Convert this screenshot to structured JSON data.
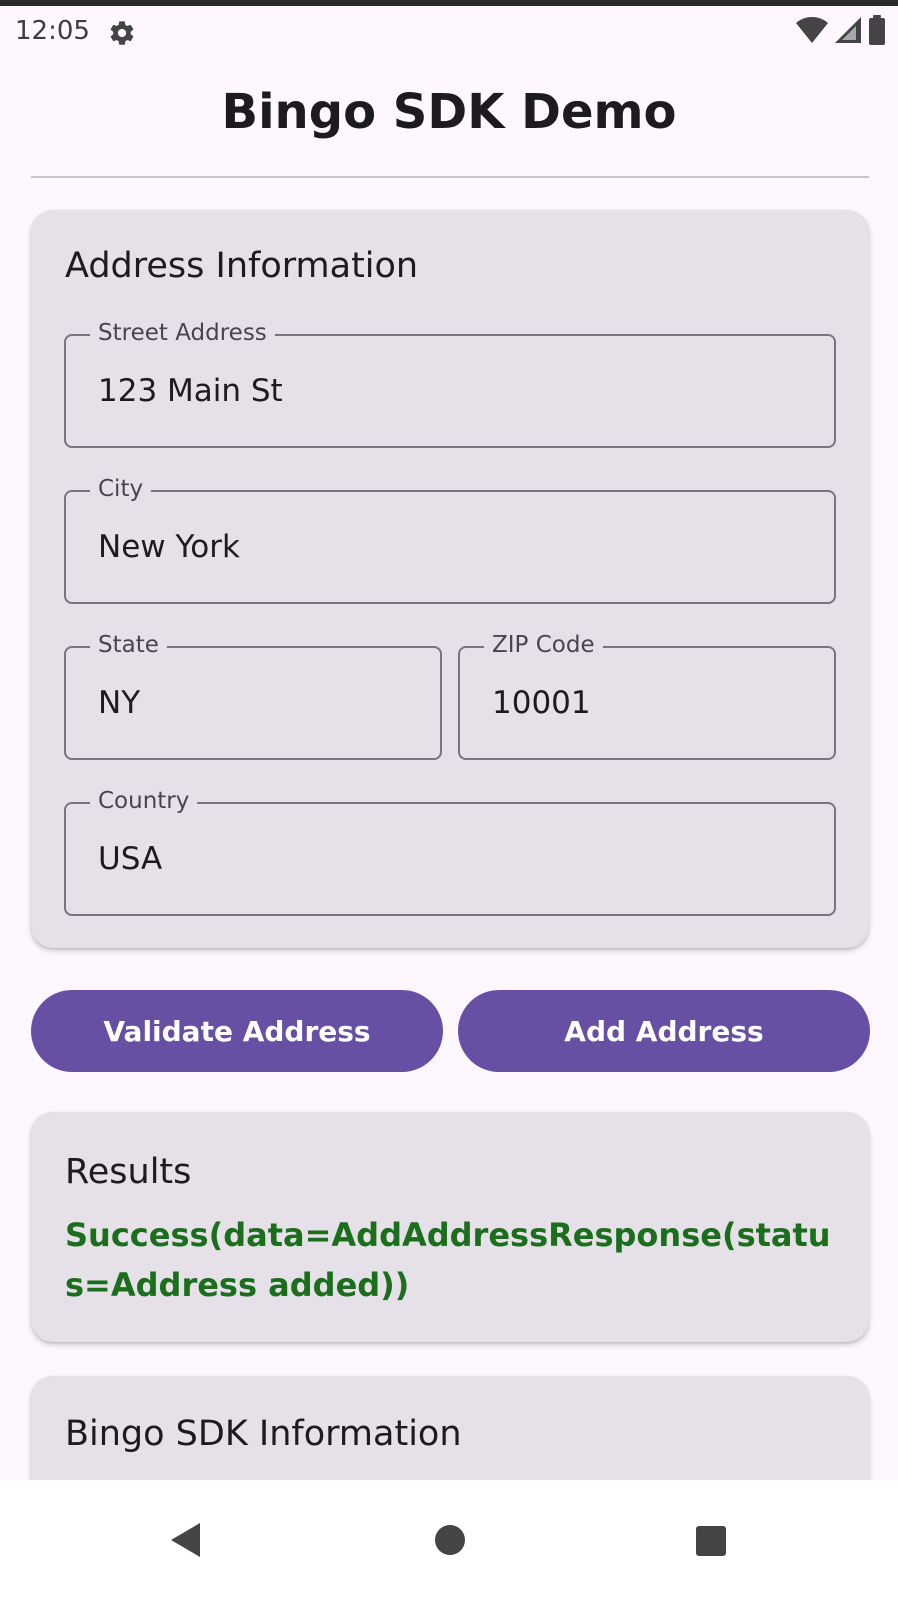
{
  "status_bar": {
    "time": "12:05",
    "icons": [
      "settings-icon",
      "wifi-icon",
      "signal-icon",
      "battery-icon"
    ]
  },
  "app": {
    "title": "Bingo SDK Demo"
  },
  "address_card": {
    "title": "Address Information",
    "fields": {
      "street": {
        "label": "Street Address",
        "value": "123 Main St"
      },
      "city": {
        "label": "City",
        "value": "New York"
      },
      "state": {
        "label": "State",
        "value": "NY"
      },
      "zip": {
        "label": "ZIP Code",
        "value": "10001"
      },
      "country": {
        "label": "Country",
        "value": "USA"
      }
    }
  },
  "actions": {
    "validate_label": "Validate Address",
    "add_label": "Add Address"
  },
  "results_card": {
    "title": "Results",
    "text": "Success(data=AddAddressResponse(status=Address added))"
  },
  "sdk_card": {
    "title": "Bingo SDK Information"
  },
  "nav": {
    "icons": [
      "back-icon",
      "home-icon",
      "recents-icon"
    ]
  },
  "colors": {
    "background": "#fef7ff",
    "card": "#e6e0e9",
    "primary": "#6750a4",
    "success_text": "#1b6e1b"
  }
}
